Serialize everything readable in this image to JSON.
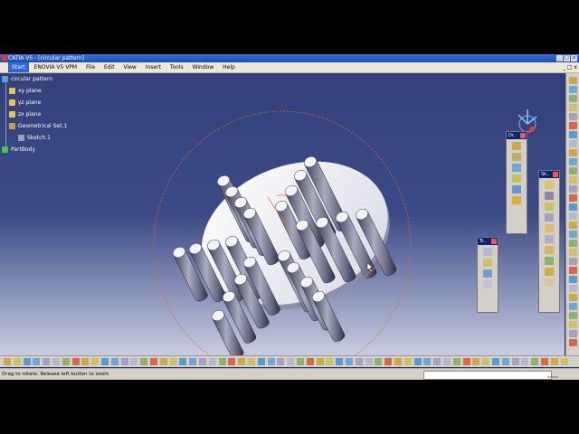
{
  "window": {
    "title": "CATIA V5 - [circular pattern]"
  },
  "menu": {
    "items": [
      "Start",
      "ENOVIA V5 VPM",
      "File",
      "Edit",
      "View",
      "Insert",
      "Tools",
      "Window",
      "Help"
    ]
  },
  "tree": {
    "root": "circular pattern",
    "xy": "xy plane",
    "yz": "yz plane",
    "zx": "zx plane",
    "geoset": "Geometrical Set.1",
    "sketch": "Sketch.1",
    "partbody": "PartBody"
  },
  "toolbars": {
    "t1": "Dr..",
    "t2": "Sk..",
    "t3": "Tr.."
  },
  "status": {
    "text": "Drag to rotate. Release left button to zoom"
  },
  "colors": {
    "background_top": "#33407a",
    "background_bottom": "#c9cde0",
    "pattern_circle": "#d66a3a",
    "accent_blue": "#2f67d0"
  }
}
